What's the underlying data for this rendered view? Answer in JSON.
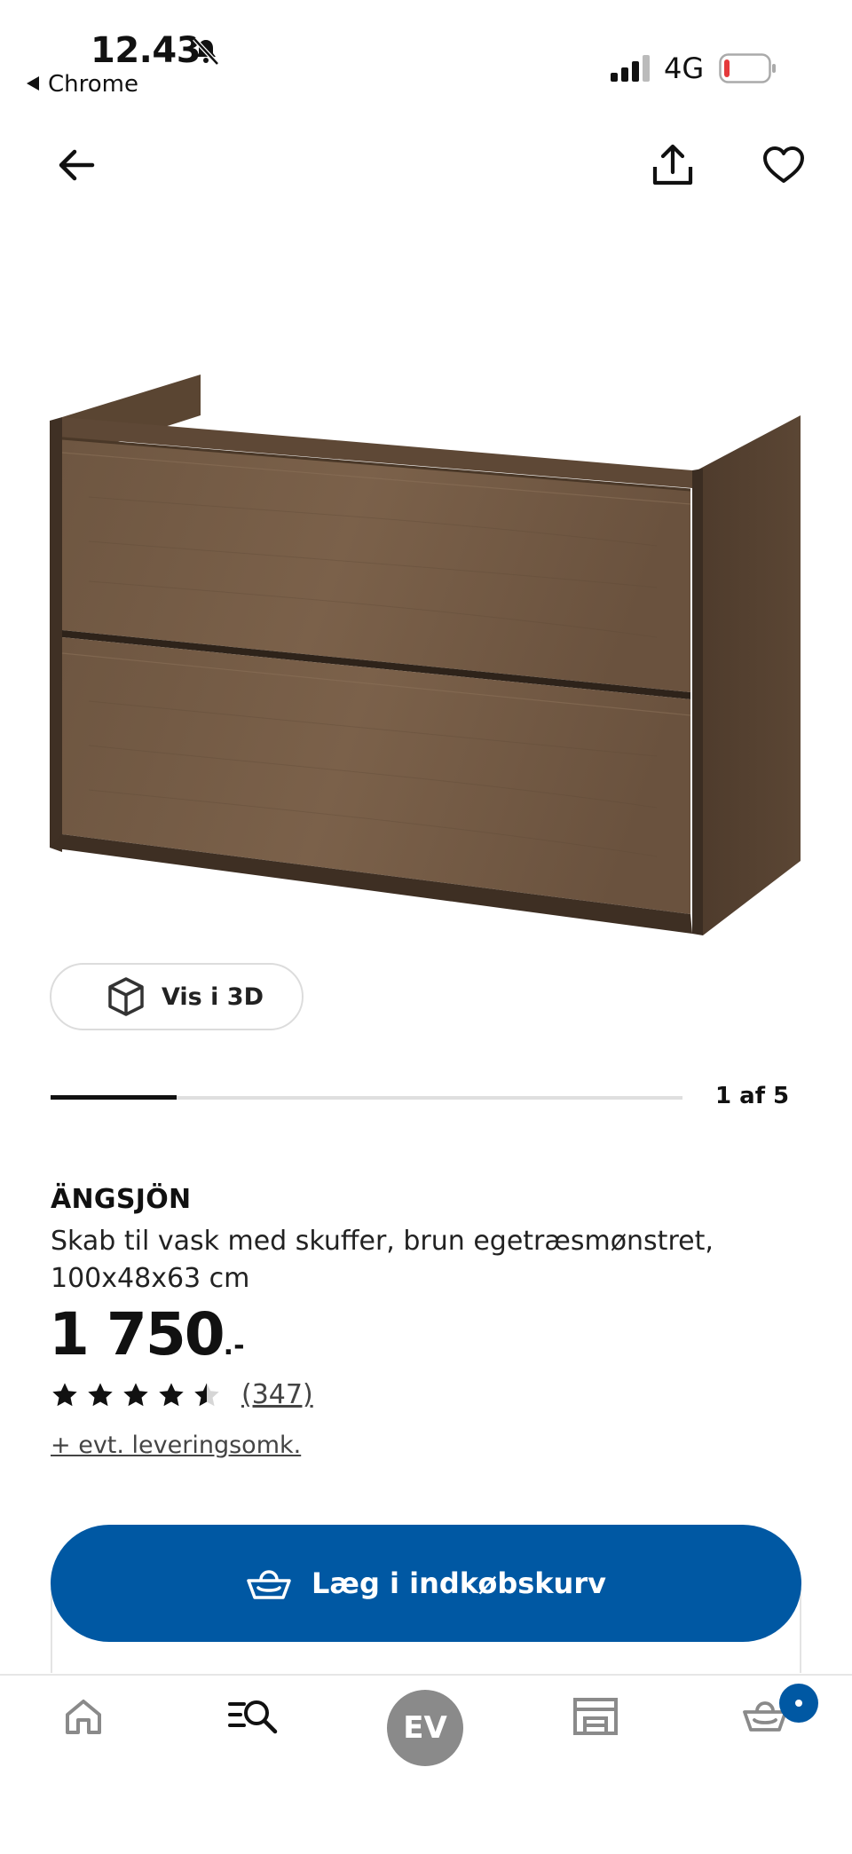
{
  "status_bar": {
    "time": "12.43",
    "back_app": "Chrome",
    "network": "4G",
    "battery_color": "#e5393b"
  },
  "nav": {
    "back_icon": "arrow-left-icon",
    "share_icon": "share-icon",
    "favorite_icon": "heart-icon"
  },
  "gallery": {
    "view3d_label": "Vis i 3D",
    "counter": "1 af 5",
    "current": 1,
    "total": 5
  },
  "product": {
    "name": "ÄNGSJÖN",
    "description": "Skab til vask med skuffer, brun egetræsmønstret, 100x48x63 cm",
    "price": "1 750",
    "price_suffix": ".-",
    "rating": 4.5,
    "rating_max": 5,
    "review_count": "(347)",
    "delivery_note": "+ evt. leveringsomk."
  },
  "actions": {
    "add_to_cart": "Læg i indkøbskurv",
    "accent_color": "#0058a3"
  },
  "tabs": [
    {
      "name": "home",
      "icon": "home-icon"
    },
    {
      "name": "search",
      "icon": "search-list-icon"
    },
    {
      "name": "profile",
      "initials": "EV"
    },
    {
      "name": "stores",
      "icon": "store-icon"
    },
    {
      "name": "cart",
      "icon": "basket-icon"
    }
  ]
}
